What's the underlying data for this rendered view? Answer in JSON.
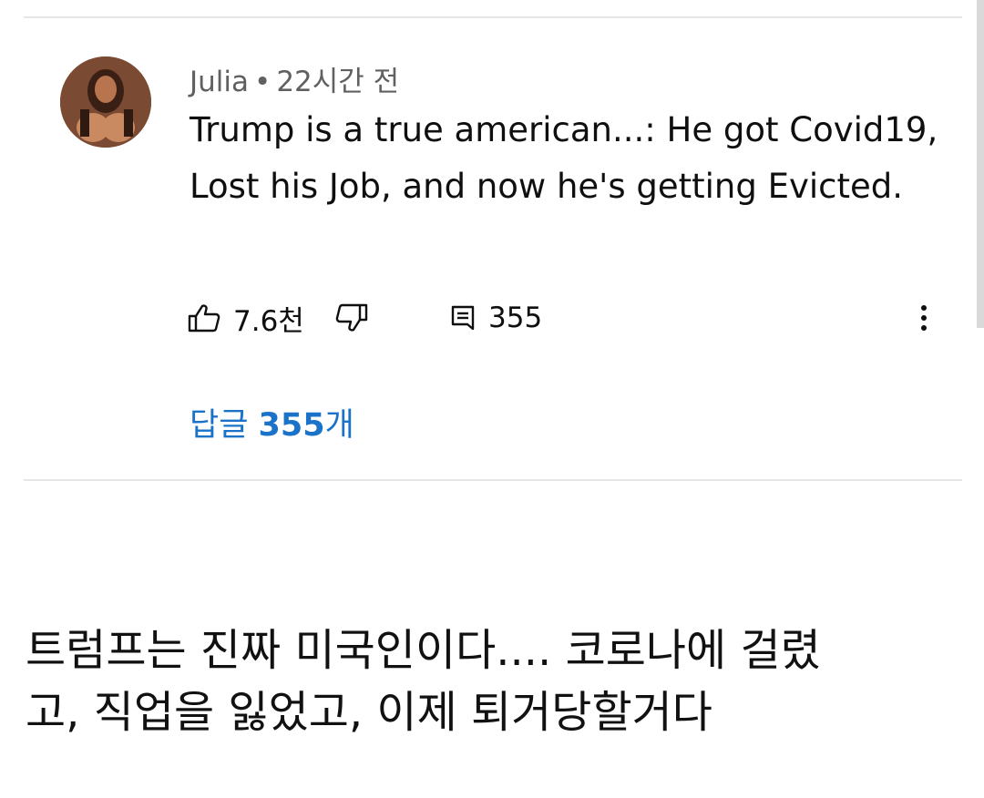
{
  "comment": {
    "author": "Julia",
    "separator": "•",
    "time": "22시간 전",
    "text": "Trump is a true american...: He got Covid19, Lost his Job, and now he's getting Evicted.",
    "likes": "7.6천",
    "reply_count": "355",
    "replies_link": {
      "prefix": "답글",
      "count": "355",
      "suffix": "개"
    }
  },
  "icons": {
    "avatar": "avatar",
    "like": "thumbs-up-icon",
    "dislike": "thumbs-down-icon",
    "reply": "comment-icon",
    "more": "more-vertical-icon"
  },
  "colors": {
    "link": "#1a73c8",
    "meta": "#606060",
    "text": "#0f0f0f"
  },
  "caption": {
    "line1": "트럼프는 진짜 미국인이다.... 코로나에 걸렸",
    "line2": "고, 직업을 잃었고, 이제 퇴거당할거다"
  }
}
